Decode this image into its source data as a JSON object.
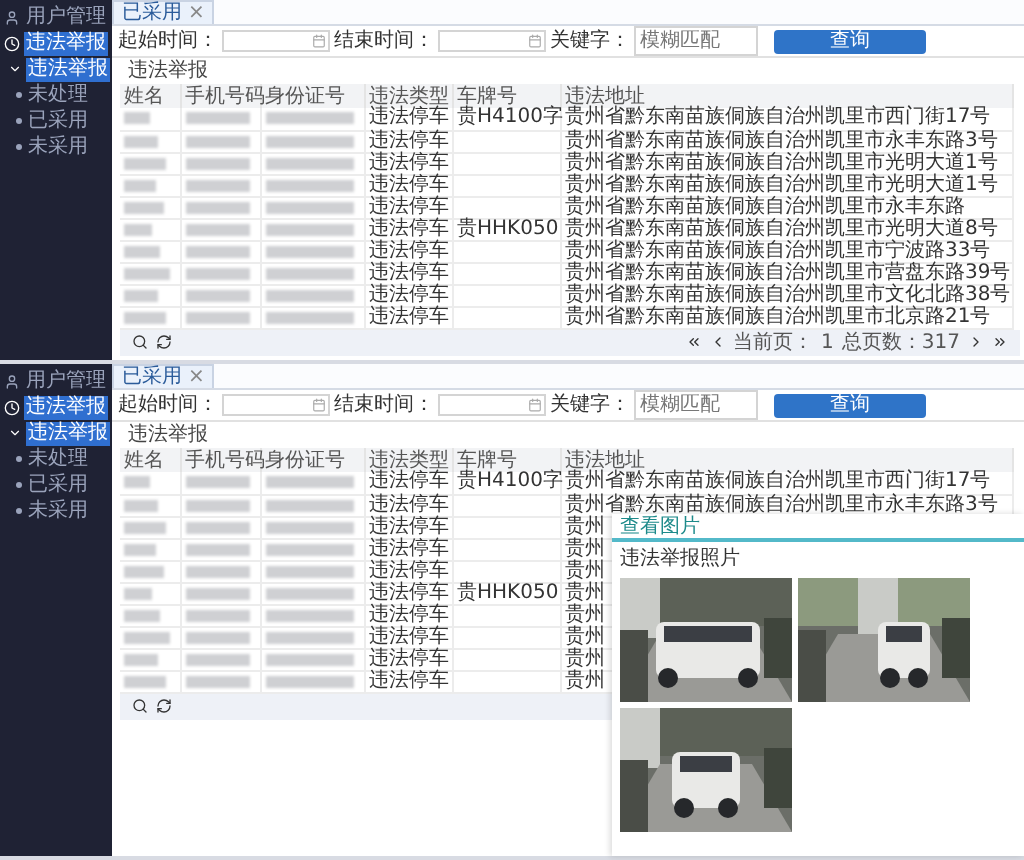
{
  "panels": [
    {
      "sidebar": {
        "items": [
          {
            "label": "用户管理",
            "selected": false
          },
          {
            "label": "违法举报",
            "selected": true,
            "children": [
              {
                "label": "违法举报",
                "selected": true,
                "children": [
                  {
                    "label": "未处理",
                    "selected": false
                  },
                  {
                    "label": "已采用",
                    "selected": false
                  },
                  {
                    "label": "未采用",
                    "selected": false
                  }
                ]
              }
            ]
          }
        ]
      },
      "tab": {
        "label": "已采用",
        "close": "×"
      },
      "filters": {
        "start_label": "起始时间：",
        "end_label": "结束时间：",
        "keyword_label": "关键字：",
        "keyword_placeholder": "模糊匹配",
        "button": "查询"
      },
      "section_title": "违法举报",
      "columns": [
        "姓名",
        "手机号码",
        "身份证号",
        "违法类型",
        "车牌号",
        "违法地址"
      ],
      "rows": [
        {
          "type": "违法停车",
          "plate": "贵H4100字",
          "address": "贵州省黔东南苗族侗族自治州凯里市西门街17号"
        },
        {
          "type": "违法停车",
          "address": "贵州省黔东南苗族侗族自治州凯里市永丰东路3号"
        },
        {
          "type": "违法停车",
          "address": "贵州省黔东南苗族侗族自治州凯里市光明大道1号"
        },
        {
          "type": "违法停车",
          "address": "贵州省黔东南苗族侗族自治州凯里市光明大道1号"
        },
        {
          "type": "违法停车",
          "address": "贵州省黔东南苗族侗族自治州凯里市永丰东路"
        },
        {
          "type": "违法停车",
          "plate": "贵HHK050",
          "address": "贵州省黔东南苗族侗族自治州凯里市光明大道8号"
        },
        {
          "type": "违法停车",
          "address": "贵州省黔东南苗族侗族自治州凯里市宁波路33号"
        },
        {
          "type": "违法停车",
          "address": "贵州省黔东南苗族侗族自治州凯里市营盘东路39号"
        },
        {
          "type": "违法停车",
          "address": "贵州省黔东南苗族侗族自治州凯里市文化北路38号"
        },
        {
          "type": "违法停车",
          "address": "贵州省黔东南苗族侗族自治州凯里市北京路21号"
        }
      ],
      "pager": {
        "current_label": "当前页：",
        "current": "1",
        "total": "总页数：317"
      }
    },
    {
      "sidebar": {
        "items": [
          {
            "label": "用户管理",
            "selected": false
          },
          {
            "label": "违法举报",
            "selected": true,
            "children": [
              {
                "label": "违法举报",
                "selected": true,
                "children": [
                  {
                    "label": "未处理",
                    "selected": false
                  },
                  {
                    "label": "已采用",
                    "selected": false
                  },
                  {
                    "label": "未采用",
                    "selected": false
                  }
                ]
              }
            ]
          }
        ]
      },
      "tab": {
        "label": "已采用",
        "close": "×"
      },
      "filters": {
        "start_label": "起始时间：",
        "end_label": "结束时间：",
        "keyword_label": "关键字：",
        "keyword_placeholder": "模糊匹配",
        "button": "查询"
      },
      "section_title": "违法举报",
      "columns": [
        "姓名",
        "手机号码",
        "身份证号",
        "违法类型",
        "车牌号",
        "违法地址"
      ],
      "rows": [
        {
          "type": "违法停车",
          "plate": "贵H4100字",
          "address": "贵州省黔东南苗族侗族自治州凯里市西门街17号"
        },
        {
          "type": "违法停车",
          "address": "贵州省黔东南苗族侗族自治州凯里市永丰东路3号"
        },
        {
          "type": "违法停车",
          "address": "贵州"
        },
        {
          "type": "违法停车",
          "address": "贵州"
        },
        {
          "type": "违法停车",
          "address": "贵州"
        },
        {
          "type": "违法停车",
          "plate": "贵HHK050",
          "address": "贵州"
        },
        {
          "type": "违法停车",
          "address": "贵州"
        },
        {
          "type": "违法停车",
          "address": "贵州"
        },
        {
          "type": "违法停车",
          "address": "贵州"
        },
        {
          "type": "违法停车",
          "address": "贵州"
        }
      ],
      "popup": {
        "title": "查看图片",
        "caption": "违法举报照片"
      }
    }
  ]
}
